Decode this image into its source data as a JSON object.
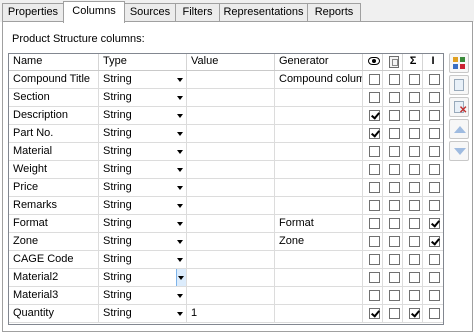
{
  "tabs": [
    {
      "label": "Properties",
      "active": false
    },
    {
      "label": "Columns",
      "active": true
    },
    {
      "label": "Sources",
      "active": false
    },
    {
      "label": "Filters",
      "active": false
    },
    {
      "label": "Representations",
      "active": false
    },
    {
      "label": "Reports",
      "active": false
    }
  ],
  "caption": "Product Structure columns:",
  "columns": {
    "name": "Name",
    "type": "Type",
    "value": "Value",
    "generator": "Generator",
    "icons": [
      "eye-icon",
      "page-icon",
      "sigma-icon",
      "cursor-icon"
    ],
    "sigma_symbol": "Σ",
    "cursor_symbol": "I"
  },
  "rows": [
    {
      "name": "Compound Title",
      "type": "String",
      "value": "",
      "generator": "Compound column",
      "flags": [
        false,
        false,
        false,
        false
      ]
    },
    {
      "name": "Section",
      "type": "String",
      "value": "",
      "generator": "",
      "flags": [
        false,
        false,
        false,
        false
      ]
    },
    {
      "name": "Description",
      "type": "String",
      "value": "",
      "generator": "",
      "flags": [
        true,
        false,
        false,
        false
      ]
    },
    {
      "name": "Part No.",
      "type": "String",
      "value": "",
      "generator": "",
      "flags": [
        true,
        false,
        false,
        false
      ]
    },
    {
      "name": "Material",
      "type": "String",
      "value": "",
      "generator": "",
      "flags": [
        false,
        false,
        false,
        false
      ]
    },
    {
      "name": "Weight",
      "type": "String",
      "value": "",
      "generator": "",
      "flags": [
        false,
        false,
        false,
        false
      ]
    },
    {
      "name": "Price",
      "type": "String",
      "value": "",
      "generator": "",
      "flags": [
        false,
        false,
        false,
        false
      ]
    },
    {
      "name": "Remarks",
      "type": "String",
      "value": "",
      "generator": "",
      "flags": [
        false,
        false,
        false,
        false
      ]
    },
    {
      "name": "Format",
      "type": "String",
      "value": "",
      "generator": "Format",
      "flags": [
        false,
        false,
        false,
        true
      ]
    },
    {
      "name": "Zone",
      "type": "String",
      "value": "",
      "generator": "Zone",
      "flags": [
        false,
        false,
        false,
        true
      ]
    },
    {
      "name": "CAGE Code",
      "type": "String",
      "value": "",
      "generator": "",
      "flags": [
        false,
        false,
        false,
        false
      ]
    },
    {
      "name": "Material2",
      "type": "String",
      "value": "",
      "generator": "",
      "flags": [
        false,
        false,
        false,
        false
      ]
    },
    {
      "name": "Material3",
      "type": "String",
      "value": "",
      "generator": "",
      "flags": [
        false,
        false,
        false,
        false
      ]
    },
    {
      "name": "Quantity",
      "type": "String",
      "value": "1",
      "generator": "",
      "flags": [
        true,
        false,
        true,
        false
      ]
    }
  ],
  "toolbar": [
    "add-column-icon",
    "copy-column-icon",
    "delete-column-icon",
    "move-up-icon",
    "move-down-icon"
  ]
}
